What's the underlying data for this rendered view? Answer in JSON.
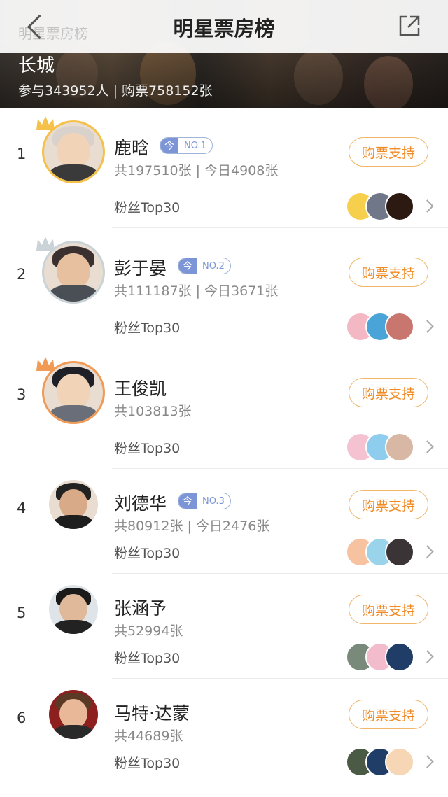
{
  "header": {
    "title": "明星票房榜",
    "faded_title": "明星票房榜",
    "movie_title": "长城",
    "movie_stats": "参与343952人 | 购票758152张"
  },
  "rows": [
    {
      "rank": "1",
      "name": "鹿晗",
      "badge_today": "今",
      "badge_no": "NO.1",
      "stats": "共197510张 | 今日4908张",
      "fans": "粉丝Top30",
      "button": "购票支持",
      "crown": "gold"
    },
    {
      "rank": "2",
      "name": "彭于晏",
      "badge_today": "今",
      "badge_no": "NO.2",
      "stats": "共111187张 | 今日3671张",
      "fans": "粉丝Top30",
      "button": "购票支持",
      "crown": "silver"
    },
    {
      "rank": "3",
      "name": "王俊凯",
      "stats": "共103813张",
      "fans": "粉丝Top30",
      "button": "购票支持",
      "crown": "bronze"
    },
    {
      "rank": "4",
      "name": "刘德华",
      "badge_today": "今",
      "badge_no": "NO.3",
      "stats": "共80912张 | 今日2476张",
      "fans": "粉丝Top30",
      "button": "购票支持"
    },
    {
      "rank": "5",
      "name": "张涵予",
      "stats": "共52994张",
      "fans": "粉丝Top30",
      "button": "购票支持"
    },
    {
      "rank": "6",
      "name": "马特·达蒙",
      "stats": "共44689张",
      "fans": "粉丝Top30",
      "button": "购票支持"
    }
  ],
  "colors": {
    "accent": "#f08a24",
    "badge": "#7b95d6",
    "gold": "#f5c14a",
    "silver": "#c9d3d8",
    "bronze": "#f09a55"
  }
}
